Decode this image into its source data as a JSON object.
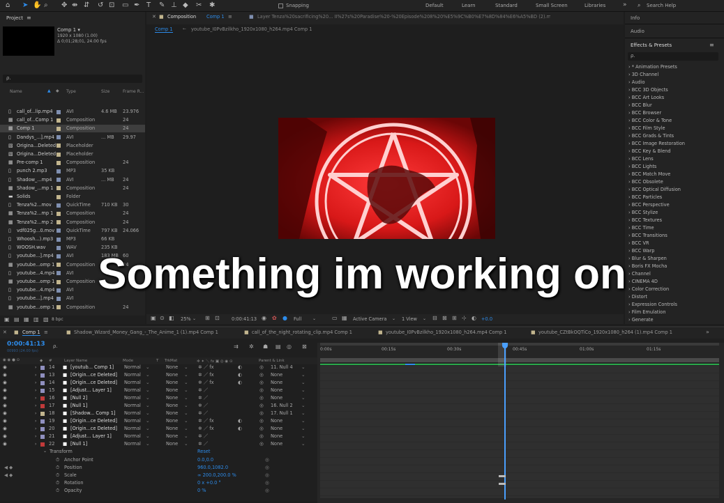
{
  "toolbar": {
    "snapping": "Snapping",
    "workspaces": [
      "Default",
      "Learn",
      "Standard",
      "Small Screen",
      "Libraries"
    ],
    "search_help": "Search Help",
    "more": "»"
  },
  "project": {
    "tab": "Project",
    "menu_icon": "≡",
    "comp_name": "Comp 1 ▾",
    "comp_res": "1920 x 1080 (1.00)",
    "comp_dur": "Δ 0;01;28;01, 24.00 fps",
    "search_placeholder": "ρ.",
    "columns": {
      "name": "Name",
      "type": "Type",
      "size": "Size",
      "frame": "Frame R..."
    },
    "items": [
      {
        "name": "call_of...lip.mp4",
        "type": "AVI",
        "size": "4.6 MB",
        "frame": "23.976",
        "color": "#7f8fb0",
        "icon": "file"
      },
      {
        "name": "call_of...Comp 1",
        "type": "Composition",
        "size": "",
        "frame": "24",
        "color": "#c2b58e",
        "icon": "comp"
      },
      {
        "name": "Comp 1",
        "type": "Composition",
        "size": "",
        "frame": "24",
        "color": "#c2b58e",
        "icon": "comp",
        "selected": true
      },
      {
        "name": "Dandys_...].mp4",
        "type": "AVI",
        "size": "... MB",
        "frame": "29.97",
        "color": "#7f8fb0",
        "icon": "file"
      },
      {
        "name": "Origina...Deleted",
        "type": "Placeholder",
        "size": "",
        "frame": "",
        "color": "#c2b58e",
        "icon": "ph"
      },
      {
        "name": "Origina...Deleted",
        "type": "Placeholder",
        "size": "",
        "frame": "",
        "color": "#c2b58e",
        "icon": "ph"
      },
      {
        "name": "Pre-comp 1",
        "type": "Composition",
        "size": "",
        "frame": "24",
        "color": "#c2b58e",
        "icon": "comp"
      },
      {
        "name": "punch 2.mp3",
        "type": "MP3",
        "size": "35 KB",
        "frame": "",
        "color": "#7f8fb0",
        "icon": "file"
      },
      {
        "name": "Shadow_...mp4",
        "type": "AVI",
        "size": "... MB",
        "frame": "24",
        "color": "#7f8fb0",
        "icon": "file"
      },
      {
        "name": "Shadow_...mp 1",
        "type": "Composition",
        "size": "",
        "frame": "24",
        "color": "#c2b58e",
        "icon": "comp"
      },
      {
        "name": "Solids",
        "type": "Folder",
        "size": "",
        "frame": "",
        "color": "#c2b58e",
        "icon": "folder"
      },
      {
        "name": "Tenza%2...mov",
        "type": "QuickTime",
        "size": "710 KB",
        "frame": "30",
        "color": "#7f8fb0",
        "icon": "file"
      },
      {
        "name": "Tenza%2...mp 1",
        "type": "Composition",
        "size": "",
        "frame": "24",
        "color": "#c2b58e",
        "icon": "comp"
      },
      {
        "name": "Tenza%2...mp 2",
        "type": "Composition",
        "size": "",
        "frame": "24",
        "color": "#c2b58e",
        "icon": "comp"
      },
      {
        "name": "vdf025g...0.mov",
        "type": "QuickTime",
        "size": "797 KB",
        "frame": "24.066",
        "color": "#7f8fb0",
        "icon": "file"
      },
      {
        "name": "Whoosh...).mp3",
        "type": "MP3",
        "size": "66 KB",
        "frame": "",
        "color": "#7f8fb0",
        "icon": "file"
      },
      {
        "name": "WOOSH.wav",
        "type": "WAV",
        "size": "235 KB",
        "frame": "",
        "color": "#7f8fb0",
        "icon": "file"
      },
      {
        "name": "youtube...].mp4",
        "type": "AVI",
        "size": "183 MB",
        "frame": "60",
        "color": "#7f8fb0",
        "icon": "file"
      },
      {
        "name": "youtube...omp 1",
        "type": "Composition",
        "size": "",
        "frame": "24",
        "color": "#c2b58e",
        "icon": "comp"
      },
      {
        "name": "youtube...4.mp4",
        "type": "AVI",
        "size": "",
        "frame": "",
        "color": "#7f8fb0",
        "icon": "file"
      },
      {
        "name": "youtube...omp 1",
        "type": "Composition",
        "size": "",
        "frame": "",
        "color": "#c2b58e",
        "icon": "comp"
      },
      {
        "name": "youtube...4.mp4",
        "type": "AVI",
        "size": "",
        "frame": "",
        "color": "#7f8fb0",
        "icon": "file"
      },
      {
        "name": "youtube...].mp4",
        "type": "AVI",
        "size": "",
        "frame": "",
        "color": "#7f8fb0",
        "icon": "file"
      },
      {
        "name": "youtube...omp 1",
        "type": "Composition",
        "size": "",
        "frame": "24",
        "color": "#c2b58e",
        "icon": "comp"
      }
    ],
    "bpc": "8 bpc"
  },
  "comp": {
    "tab": "Composition",
    "tab_name": "Comp 1",
    "layer_tab": "Layer Tenza%20sacrificing%20... II%27s%20Paradise%20-%20Episode%208%20%E5%9C%B0%E7%8D%84%E6%A5%BD (2).mov",
    "breadcrumb1": "Comp 1",
    "breadcrumb2": "youtube_I0PvBzilkho_1920x1080_h264.mp4 Comp 1",
    "zoom": "25%",
    "time": "0:00:41:13",
    "quality": "Full",
    "camera": "Active Camera",
    "views": "1 View",
    "offset": "+0.0"
  },
  "right": {
    "info": "Info",
    "audio": "Audio",
    "effects_title": "Effects & Presets",
    "search": "ρ.",
    "effects": [
      "* Animation Presets",
      "3D Channel",
      "Audio",
      "BCC 3D Objects",
      "BCC Art Looks",
      "BCC Blur",
      "BCC Browser",
      "BCC Color & Tone",
      "BCC Film Style",
      "BCC Grads & Tints",
      "BCC Image Restoration",
      "BCC Key & Blend",
      "BCC Lens",
      "BCC Lights",
      "BCC Match Move",
      "BCC Obsolete",
      "BCC Optical Diffusion",
      "BCC Particles",
      "BCC Perspective",
      "BCC Stylize",
      "BCC Textures",
      "BCC Time",
      "BCC Transitions",
      "BCC VR",
      "BCC Warp",
      "Blur & Sharpen",
      "Boris FX Mocha",
      "Channel",
      "CINEMA 4D",
      "Color Correction",
      "Distort",
      "Expression Controls",
      "Film Emulation",
      "Generate"
    ]
  },
  "timeline": {
    "tabs": [
      "Comp 1",
      "Shadow_Wizard_Money_Gang_-_The_Anime_1 (1).mp4 Comp 1",
      "call_of_the_night_rotating_clip.mp4 Comp 1",
      "youtube_I0PvBzilkho_1920x1080_h264.mp4 Comp 1",
      "youtube_CZtBkOQTiCo_1920x1080_h264 (1).mp4 Comp 1"
    ],
    "current_time": "0:00:41:13",
    "fps_sub": "00993 (24.00 fps)",
    "search": "ρ.",
    "headers": {
      "num": "#",
      "layer_name": "Layer Name",
      "mode": "Mode",
      "t": "T",
      "trkmat": "TrkMat",
      "parent": "Parent & Link"
    },
    "ruler": [
      "0:00s",
      "00:15s",
      "00:30s",
      "00:45s",
      "01:00s",
      "01:15s"
    ],
    "layers": [
      {
        "num": "14",
        "name": "[youtub... Comp 1]",
        "mode": "Normal",
        "trk": "None",
        "parent": "11. Null 4",
        "color": "#8f8fbf",
        "fx": true
      },
      {
        "num": "13",
        "name": "[Origin...ce Deleted]",
        "mode": "Normal",
        "trk": "None",
        "parent": "None",
        "color": "#8f8fbf",
        "fx": true
      },
      {
        "num": "14",
        "name": "[Origin...ce Deleted]",
        "mode": "Normal",
        "trk": "None",
        "parent": "None",
        "color": "#8f8fbf",
        "fx": true
      },
      {
        "num": "15",
        "name": "[Adjust... Layer 1]",
        "mode": "Normal",
        "trk": "None",
        "parent": "None",
        "color": "#8f8fbf",
        "fx": false
      },
      {
        "num": "16",
        "name": "[Null 2]",
        "mode": "Normal",
        "trk": "None",
        "parent": "None",
        "color": "#c03a3a",
        "fx": false
      },
      {
        "num": "17",
        "name": "[Null 1]",
        "mode": "Normal",
        "trk": "None",
        "parent": "16. Null 2",
        "color": "#c03a3a",
        "fx": false
      },
      {
        "num": "18",
        "name": "[Shadow... Comp 1]",
        "mode": "Normal",
        "trk": "None",
        "parent": "17. Null 1",
        "color": "#c2b58e",
        "fx": false
      },
      {
        "num": "19",
        "name": "[Origin...ce Deleted]",
        "mode": "Normal",
        "trk": "None",
        "parent": "None",
        "color": "#8f8fbf",
        "fx": true
      },
      {
        "num": "20",
        "name": "[Origin...ce Deleted]",
        "mode": "Normal",
        "trk": "None",
        "parent": "None",
        "color": "#8f8fbf",
        "fx": true
      },
      {
        "num": "21",
        "name": "[Adjust... Layer 1]",
        "mode": "Normal",
        "trk": "None",
        "parent": "None",
        "color": "#8f8fbf",
        "fx": false
      },
      {
        "num": "22",
        "name": "[Null 1]",
        "mode": "Normal",
        "trk": "None",
        "parent": "None",
        "color": "#c03a3a",
        "fx": false
      }
    ],
    "transform": {
      "label": "Transform",
      "reset": "Reset",
      "props": [
        {
          "name": "Anchor Point",
          "value": "0.0,0.0"
        },
        {
          "name": "Position",
          "value": "960.0,1082.0"
        },
        {
          "name": "Scale",
          "value": "∞ 200.0,200.0 %"
        },
        {
          "name": "Rotation",
          "value": "0 x +0.0 °"
        },
        {
          "name": "Opacity",
          "value": "0 %"
        }
      ]
    }
  },
  "caption": "Something im working on",
  "colors": {
    "accent": "#2d8ceb",
    "playhead": "#4aa0ff",
    "red_preview": "#e02020"
  }
}
